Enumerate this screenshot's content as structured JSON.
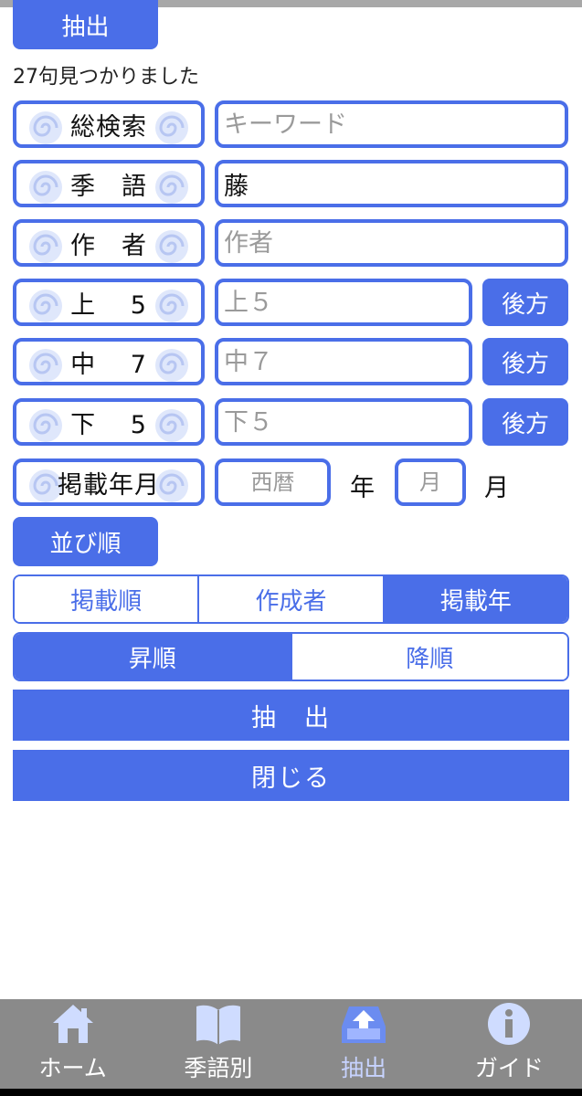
{
  "header": {
    "extract_label": "抽出"
  },
  "result_count": "27句見つかりました",
  "fields": {
    "total": {
      "label": "総検索",
      "placeholder": "キーワード",
      "value": ""
    },
    "kigo": {
      "label": "季　語",
      "placeholder": "",
      "value": "藤"
    },
    "author": {
      "label": "作　者",
      "placeholder": "作者",
      "value": ""
    },
    "upper5": {
      "label": "上　 5",
      "placeholder": "上５",
      "value": "",
      "backward": "後方"
    },
    "middle7": {
      "label": "中　 7",
      "placeholder": "中７",
      "value": "",
      "backward": "後方"
    },
    "lower5": {
      "label": "下　 5",
      "placeholder": "下５",
      "value": "",
      "backward": "後方"
    },
    "date": {
      "label": "掲載年月",
      "year_placeholder": "西暦",
      "year_unit": "年",
      "month_placeholder": "月",
      "month_unit": "月"
    }
  },
  "sort": {
    "label": "並び順",
    "keys": [
      {
        "label": "掲載順",
        "active": false
      },
      {
        "label": "作成者",
        "active": false
      },
      {
        "label": "掲載年",
        "active": true
      }
    ],
    "orders": [
      {
        "label": "昇順",
        "active": true
      },
      {
        "label": "降順",
        "active": false
      }
    ]
  },
  "actions": {
    "extract": "抽　出",
    "close": "閉じる"
  },
  "tabbar": {
    "items": [
      {
        "label": "ホーム",
        "icon": "home-icon"
      },
      {
        "label": "季語別",
        "icon": "book-icon"
      },
      {
        "label": "抽出",
        "icon": "inbox-upload-icon",
        "active": true
      },
      {
        "label": "ガイド",
        "icon": "info-icon"
      }
    ]
  },
  "colors": {
    "accent": "#4a6ee8",
    "tabbar": "#8a8a8a",
    "tab_active": "#c7d3ff"
  }
}
